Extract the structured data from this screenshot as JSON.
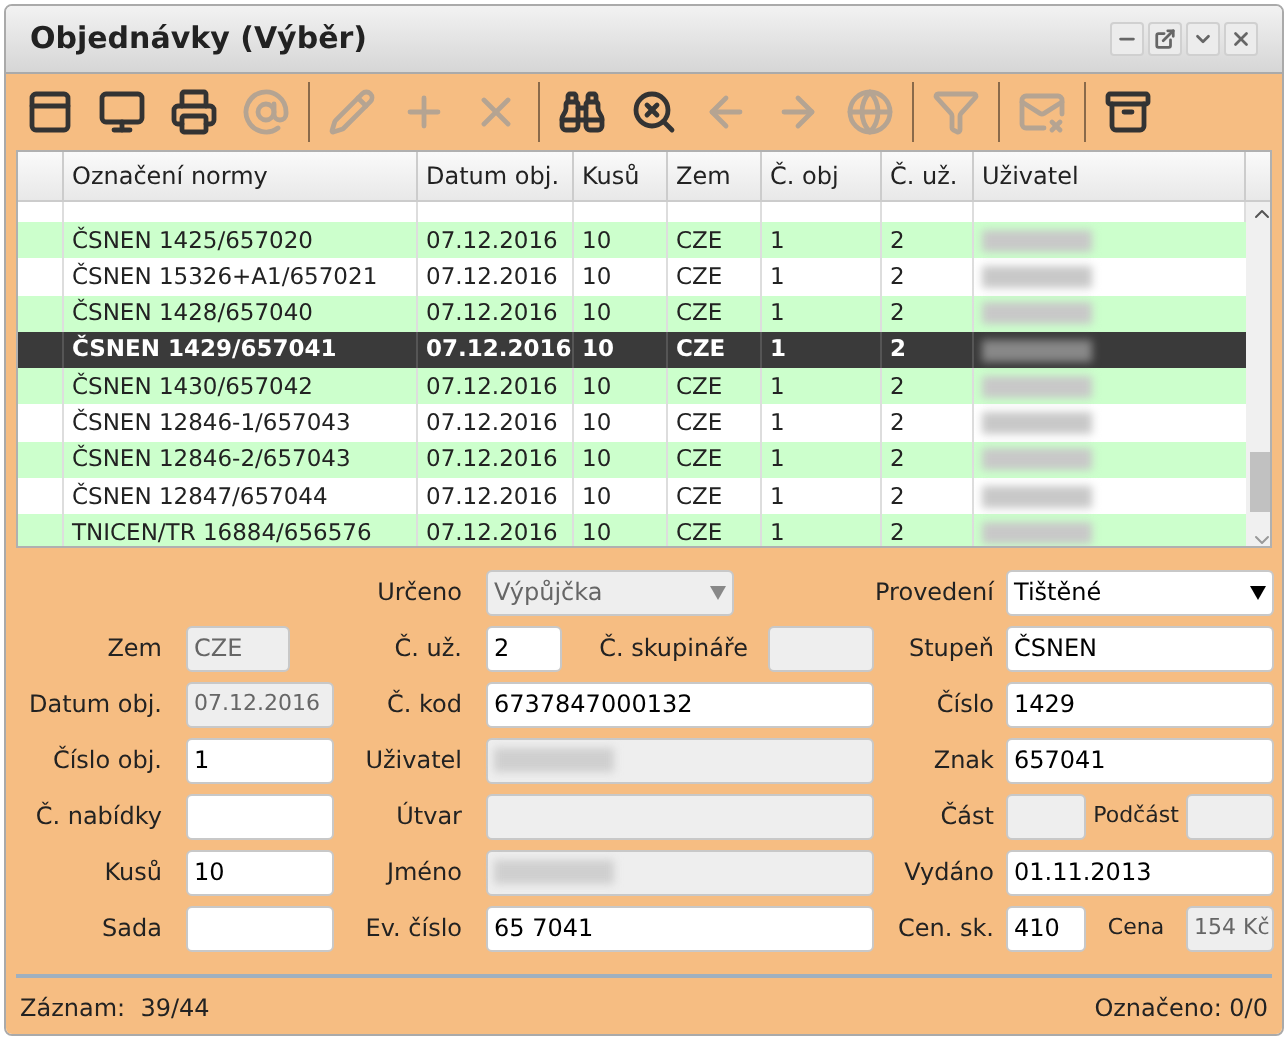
{
  "window": {
    "title": "Objednávky (Výběr)"
  },
  "toolbar": [
    {
      "kind": "window",
      "disabled": false
    },
    {
      "kind": "monitor",
      "disabled": false
    },
    {
      "kind": "printer",
      "disabled": false
    },
    {
      "kind": "at",
      "disabled": true
    },
    {
      "kind": "separator"
    },
    {
      "kind": "pencil",
      "disabled": true
    },
    {
      "kind": "plus",
      "disabled": true
    },
    {
      "kind": "delete",
      "disabled": true
    },
    {
      "kind": "separator"
    },
    {
      "kind": "binoculars",
      "disabled": false
    },
    {
      "kind": "binoculars-off",
      "disabled": false
    },
    {
      "kind": "back",
      "disabled": true
    },
    {
      "kind": "forward",
      "disabled": true
    },
    {
      "kind": "globe",
      "disabled": true
    },
    {
      "kind": "separator"
    },
    {
      "kind": "filter",
      "disabled": true
    },
    {
      "kind": "separator"
    },
    {
      "kind": "mail-off",
      "disabled": true
    },
    {
      "kind": "separator"
    },
    {
      "kind": "cabinet",
      "disabled": false
    }
  ],
  "table": {
    "columns": [
      "Označení normy",
      "Datum obj.",
      "Kusů",
      "Zem",
      "Č. obj",
      "Č. už.",
      "Uživatel"
    ],
    "rows": [
      {
        "cells": [
          "ČSNEN 1425/657020",
          "07.12.2016",
          "10",
          "CZE",
          "1",
          "2"
        ],
        "user_redacted": true,
        "selected": false
      },
      {
        "cells": [
          "ČSNEN 15326+A1/657021",
          "07.12.2016",
          "10",
          "CZE",
          "1",
          "2"
        ],
        "user_redacted": true,
        "selected": false
      },
      {
        "cells": [
          "ČSNEN 1428/657040",
          "07.12.2016",
          "10",
          "CZE",
          "1",
          "2"
        ],
        "user_redacted": true,
        "selected": false
      },
      {
        "cells": [
          "ČSNEN 1429/657041",
          "07.12.2016",
          "10",
          "CZE",
          "1",
          "2"
        ],
        "user_redacted": true,
        "selected": true
      },
      {
        "cells": [
          "ČSNEN 1430/657042",
          "07.12.2016",
          "10",
          "CZE",
          "1",
          "2"
        ],
        "user_redacted": true,
        "selected": false
      },
      {
        "cells": [
          "ČSNEN 12846-1/657043",
          "07.12.2016",
          "10",
          "CZE",
          "1",
          "2"
        ],
        "user_redacted": true,
        "selected": false
      },
      {
        "cells": [
          "ČSNEN 12846-2/657043",
          "07.12.2016",
          "10",
          "CZE",
          "1",
          "2"
        ],
        "user_redacted": true,
        "selected": false
      },
      {
        "cells": [
          "ČSNEN 12847/657044",
          "07.12.2016",
          "10",
          "CZE",
          "1",
          "2"
        ],
        "user_redacted": true,
        "selected": false
      },
      {
        "cells": [
          "TNICEN/TR 16884/656576",
          "07.12.2016",
          "10",
          "CZE",
          "1",
          "2"
        ],
        "user_redacted": true,
        "selected": false
      }
    ]
  },
  "form": {
    "urceno": {
      "label": "Určeno",
      "value": "Výpůjčka",
      "kind": "select",
      "disabled": true
    },
    "provedeni": {
      "label": "Provedení",
      "value": "Tištěné",
      "kind": "select",
      "disabled": false
    },
    "zem": {
      "label": "Zem",
      "value": "CZE",
      "disabled": true
    },
    "c_uz": {
      "label": "Č. už.",
      "value": "2",
      "disabled": false
    },
    "c_skupinare": {
      "label": "Č. skupináře",
      "disabled": true
    },
    "stupen": {
      "label": "Stupeň",
      "value": "ČSNEN",
      "disabled": false
    },
    "datum_obj": {
      "label": "Datum obj.",
      "value": "07.12.2016",
      "disabled": true
    },
    "c_kod": {
      "label": "Č. kod",
      "value": "6737847000132",
      "disabled": false
    },
    "cislo": {
      "label": "Číslo",
      "value": "1429",
      "disabled": false
    },
    "cislo_obj": {
      "label": "Číslo obj.",
      "value": "1",
      "disabled": false
    },
    "uzivatel": {
      "label": "Uživatel",
      "disabled": true,
      "redacted": true
    },
    "znak": {
      "label": "Znak",
      "value": "657041",
      "disabled": false
    },
    "c_nabidky": {
      "label": "Č. nabídky",
      "disabled": false
    },
    "utvar": {
      "label": "Útvar",
      "disabled": true
    },
    "cast": {
      "label": "Část",
      "disabled": true
    },
    "podcast": {
      "label": "Podčást",
      "disabled": true
    },
    "kusu": {
      "label": "Kusů",
      "value": "10",
      "disabled": false
    },
    "jmeno": {
      "label": "Jméno",
      "disabled": true,
      "redacted": true
    },
    "vydano": {
      "label": "Vydáno",
      "value": "01.11.2013",
      "disabled": false
    },
    "sada": {
      "label": "Sada",
      "disabled": false
    },
    "ev_cislo": {
      "label": "Ev. číslo",
      "value": "65 7041",
      "disabled": false
    },
    "cen_sk": {
      "label": "Cen. sk.",
      "value": "410",
      "disabled": false
    },
    "cena": {
      "label": "Cena",
      "value": "154 Kč",
      "disabled": true
    }
  },
  "status_bar": {
    "record": "Záznam:  39/44",
    "marked": "Označeno: 0/0"
  }
}
